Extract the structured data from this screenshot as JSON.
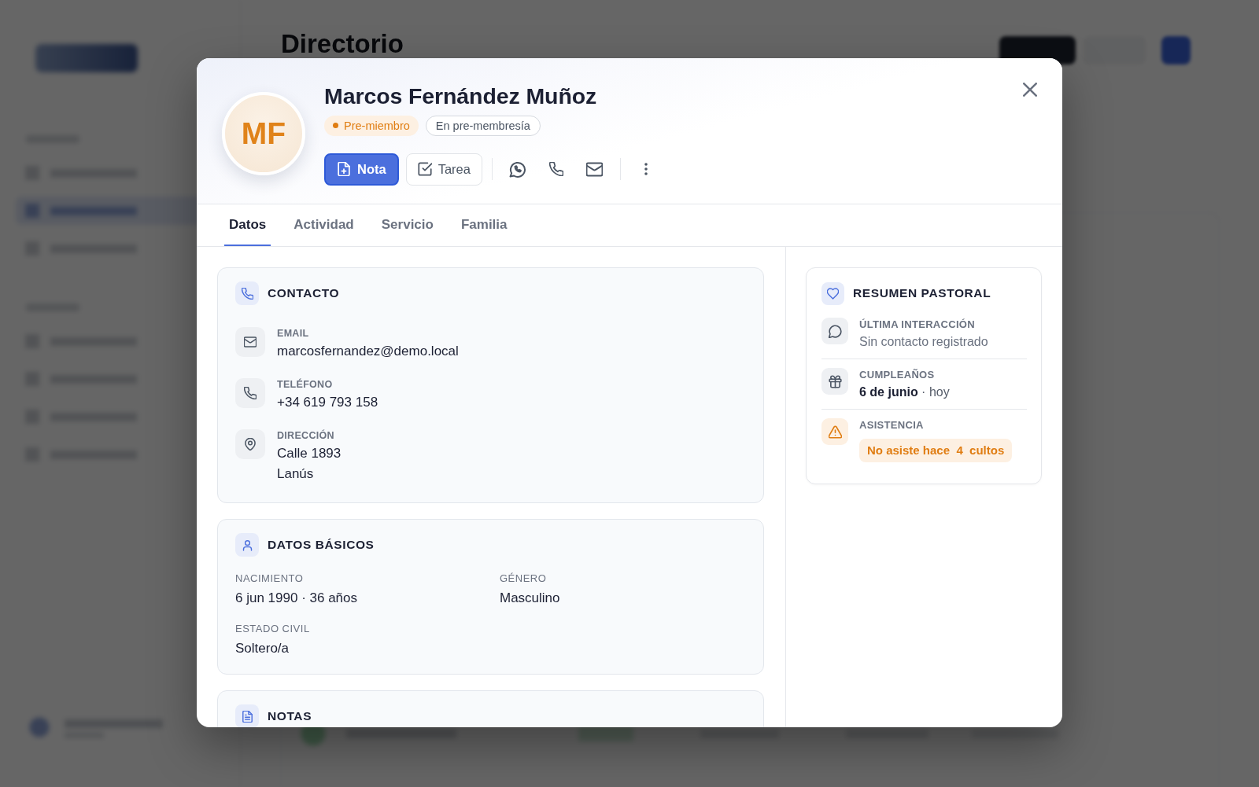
{
  "background": {
    "page_title": "Directorio"
  },
  "modal": {
    "header": {
      "initials": "MF",
      "name": "Marcos Fernández Muñoz",
      "badges": [
        {
          "kind": "status",
          "text": "Pre-miembro"
        },
        {
          "kind": "outline",
          "text": "En pre-membresía"
        }
      ],
      "actions": [
        {
          "kind": "note",
          "label": "Nota"
        },
        {
          "kind": "task",
          "label": "Tarea"
        }
      ]
    },
    "tabs": [
      {
        "label": "Datos",
        "selected": true
      },
      {
        "label": "Actividad",
        "selected": false
      },
      {
        "label": "Servicio",
        "selected": false
      },
      {
        "label": "Familia",
        "selected": false
      }
    ],
    "contact": {
      "title": "CONTACTO",
      "rows": [
        {
          "kind": "email",
          "label": "EMAIL",
          "lines": [
            "marcosfernandez@demo.local"
          ]
        },
        {
          "kind": "phone",
          "label": "TELÉFONO",
          "lines": [
            "+34 619 793 158"
          ]
        },
        {
          "kind": "address",
          "label": "DIRECCIÓN",
          "lines": [
            "Calle 1893",
            "Lanús"
          ]
        }
      ]
    },
    "basic_data": {
      "title": "DATOS BÁSICOS",
      "fields": [
        {
          "label": "NACIMIENTO",
          "value": "6 jun 1990 · 36 años"
        },
        {
          "label": "GÉNERO",
          "value": "Masculino"
        },
        {
          "label": "ESTADO CIVIL",
          "value": "Soltero/a"
        }
      ]
    },
    "notes": {
      "title": "NOTAS"
    },
    "pastoral_summary": {
      "title": "RESUMEN PASTORAL",
      "items": [
        {
          "kind": "text",
          "label": "ÚLTIMA INTERACCIÓN",
          "value": "Sin contacto registrado"
        },
        {
          "kind": "date",
          "label": "CUMPLEAÑOS",
          "value": "**6 de junio** · hoy"
        },
        {
          "kind": "alert",
          "label": "ASISTENCIA",
          "value": "No asiste hace  4  cultos"
        }
      ]
    }
  }
}
